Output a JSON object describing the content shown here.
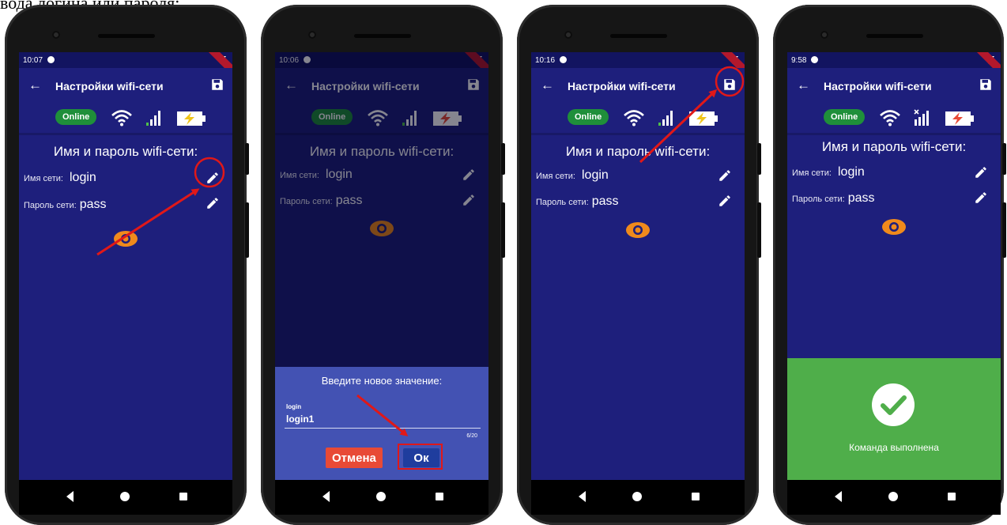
{
  "caption": "вода логина или пароля:",
  "colors": {
    "screen_bg": "#1e1f7c",
    "status_bar": "#121460",
    "online_badge": "#1f8f3a",
    "eye_icon": "#f08a1c",
    "battery_bolt": "#f0c419",
    "dialog_bg": "#4352b3",
    "cancel_button": "#e84a36",
    "ok_button": "#1f3d9e",
    "success_bg": "#4fae4a",
    "annotation": "#e01818"
  },
  "phones": [
    {
      "status": {
        "time": "10:07"
      },
      "appbar": {
        "back_icon": "arrow-back-icon",
        "title": "Настройки wifi-сети",
        "save_icon": "save-icon"
      },
      "indicators": {
        "online": "Online",
        "wifi_icon": "wifi-icon",
        "signal_icon": "signal-icon",
        "battery_icon": "battery-charging-icon"
      },
      "heading": "Имя и пароль wifi-сети:",
      "network_name": {
        "label": "Имя сети:",
        "value": "login"
      },
      "network_password": {
        "label": "Пароль сети:",
        "value": "pass"
      },
      "show_password_icon": "eye-icon",
      "annotation": "arrow pointing to the edit icon of the network name"
    },
    {
      "status": {
        "time": "10:06"
      },
      "appbar": {
        "back_icon": "arrow-back-icon",
        "title": "Настройки wifi-сети",
        "save_icon": "save-icon"
      },
      "indicators": {
        "online": "Online",
        "wifi_icon": "wifi-icon",
        "signal_icon": "signal-icon",
        "battery_icon": "battery-charging-icon"
      },
      "heading": "Имя и пароль wifi-сети:",
      "network_name": {
        "label": "Имя сети:",
        "value": "login"
      },
      "network_password": {
        "label": "Пароль сети:",
        "value": "pass"
      },
      "show_password_icon": "eye-icon",
      "dialog": {
        "prompt": "Введите новое значение:",
        "field_label": "login",
        "field_value": "login1",
        "counter": "6/20",
        "cancel_label": "Отмена",
        "ok_label": "Ок"
      },
      "annotation": "arrow pointing to the Ок button"
    },
    {
      "status": {
        "time": "10:16"
      },
      "appbar": {
        "back_icon": "arrow-back-icon",
        "title": "Настройки wifi-сети",
        "save_icon": "save-icon"
      },
      "indicators": {
        "online": "Online",
        "wifi_icon": "wifi-icon",
        "signal_icon": "signal-icon",
        "battery_icon": "battery-charging-icon"
      },
      "heading": "Имя и пароль wifi-сети:",
      "network_name": {
        "label": "Имя сети:",
        "value": "login"
      },
      "network_password": {
        "label": "Пароль сети:",
        "value": "pass"
      },
      "show_password_icon": "eye-icon",
      "annotation": "arrow pointing to the save icon"
    },
    {
      "status": {
        "time": "9:58"
      },
      "appbar": {
        "back_icon": "arrow-back-icon",
        "title": "Настройки wifi-сети",
        "save_icon": "save-icon"
      },
      "indicators": {
        "online": "Online",
        "wifi_icon": "wifi-icon",
        "signal_icon": "signal-no-data-icon",
        "battery_icon": "battery-charging-icon"
      },
      "heading": "Имя и пароль wifi-сети:",
      "network_name": {
        "label": "Имя сети:",
        "value": "login"
      },
      "network_password": {
        "label": "Пароль сети:",
        "value": "pass"
      },
      "show_password_icon": "eye-icon",
      "success": {
        "icon": "check-circle-icon",
        "message": "Команда выполнена"
      }
    }
  ]
}
